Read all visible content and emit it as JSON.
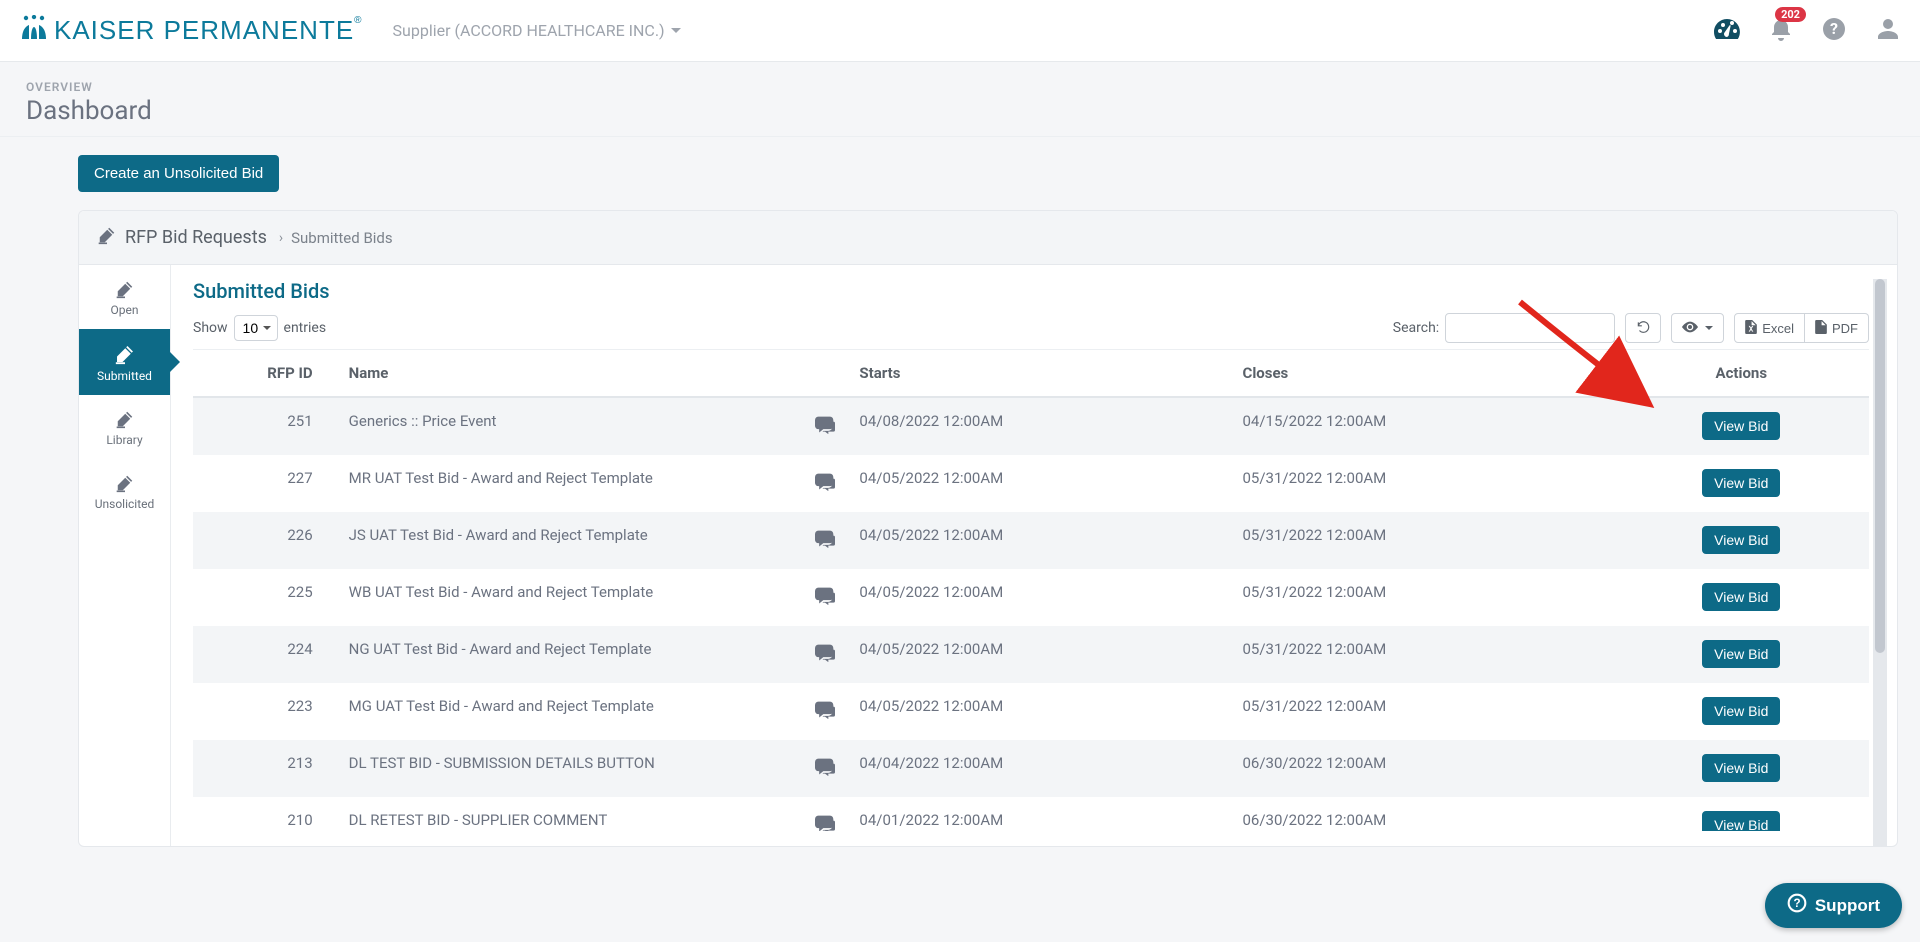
{
  "header": {
    "brand_text": "KAISER PERMANENTE",
    "supplier_label": "Supplier (ACCORD HEALTHCARE INC.)",
    "notification_count": "202"
  },
  "page": {
    "overview_label": "OVERVIEW",
    "title": "Dashboard",
    "create_button": "Create an Unsolicited Bid"
  },
  "breadcrumb": {
    "root": "RFP Bid Requests",
    "sep": "›",
    "current": "Submitted Bids"
  },
  "side_tabs": {
    "open": "Open",
    "submitted": "Submitted",
    "library": "Library",
    "unsolicited": "Unsolicited"
  },
  "table": {
    "section_title": "Submitted Bids",
    "show_label": "Show",
    "entries_label": "entries",
    "page_size": "10",
    "search_label": "Search:",
    "search_value": "",
    "excel_label": "Excel",
    "pdf_label": "PDF",
    "columns": {
      "rfp_id": "RFP ID",
      "name": "Name",
      "starts": "Starts",
      "closes": "Closes",
      "actions": "Actions"
    },
    "action_button": "View Bid",
    "rows": [
      {
        "id": "251",
        "name": "Generics :: Price Event",
        "starts": "04/08/2022 12:00AM",
        "closes": "04/15/2022 12:00AM"
      },
      {
        "id": "227",
        "name": "MR UAT Test Bid - Award and Reject Template",
        "starts": "04/05/2022 12:00AM",
        "closes": "05/31/2022 12:00AM"
      },
      {
        "id": "226",
        "name": "JS UAT Test Bid - Award and Reject Template",
        "starts": "04/05/2022 12:00AM",
        "closes": "05/31/2022 12:00AM"
      },
      {
        "id": "225",
        "name": "WB UAT Test Bid - Award and Reject Template",
        "starts": "04/05/2022 12:00AM",
        "closes": "05/31/2022 12:00AM"
      },
      {
        "id": "224",
        "name": "NG UAT Test Bid - Award and Reject Template",
        "starts": "04/05/2022 12:00AM",
        "closes": "05/31/2022 12:00AM"
      },
      {
        "id": "223",
        "name": "MG UAT Test Bid - Award and Reject Template",
        "starts": "04/05/2022 12:00AM",
        "closes": "05/31/2022 12:00AM"
      },
      {
        "id": "213",
        "name": "DL TEST BID - SUBMISSION DETAILS BUTTON",
        "starts": "04/04/2022 12:00AM",
        "closes": "06/30/2022 12:00AM"
      },
      {
        "id": "210",
        "name": "DL RETEST BID - SUPPLIER COMMENT",
        "starts": "04/01/2022 12:00AM",
        "closes": "06/30/2022 12:00AM"
      }
    ]
  },
  "support": {
    "label": "Support"
  }
}
